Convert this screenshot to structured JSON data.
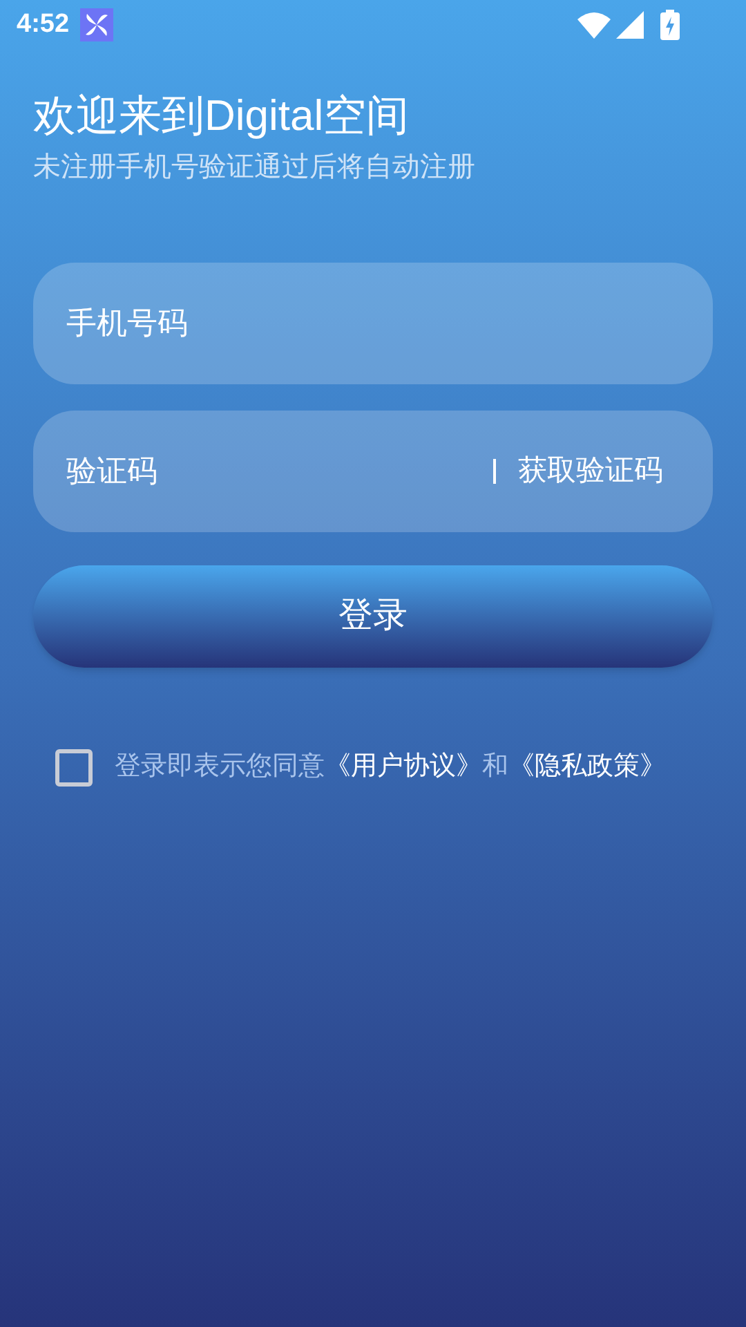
{
  "status_bar": {
    "time": "4:52"
  },
  "header": {
    "title": "欢迎来到Digital空间",
    "subtitle": "未注册手机号验证通过后将自动注册"
  },
  "phone_field": {
    "placeholder": "手机号码"
  },
  "code_field": {
    "placeholder": "验证码",
    "action": "获取验证码"
  },
  "login_button": "登录",
  "agreement": {
    "checked": false,
    "text": "登录即表示您同意",
    "links": [
      "《用户协议》",
      "《隐私政策》"
    ],
    "joiner": "和"
  }
}
